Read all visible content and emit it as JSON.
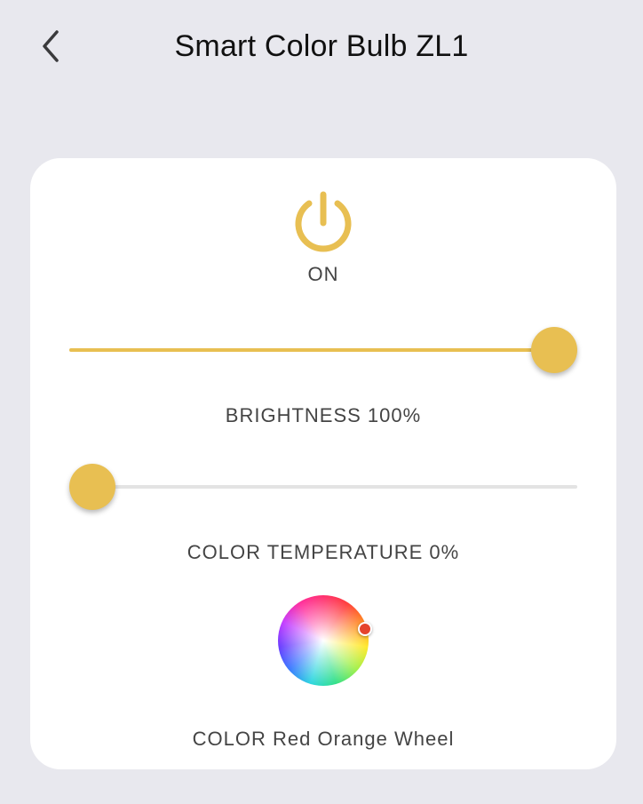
{
  "header": {
    "title": "Smart Color Bulb ZL1",
    "back_icon": "chevron-left-icon"
  },
  "power": {
    "icon": "power-icon",
    "state": "ON",
    "accent_color": "#e8bf52"
  },
  "brightness": {
    "label": "BRIGHTNESS 100%",
    "value_percent": 100
  },
  "color_temperature": {
    "label": "COLOR TEMPERATURE 0%",
    "value_percent": 0
  },
  "color": {
    "label": "COLOR Red Orange Wheel",
    "selected_color": "#e5442d"
  },
  "colors": {
    "background": "#e8e8ee",
    "card": "#ffffff",
    "accent": "#e8bf52"
  }
}
